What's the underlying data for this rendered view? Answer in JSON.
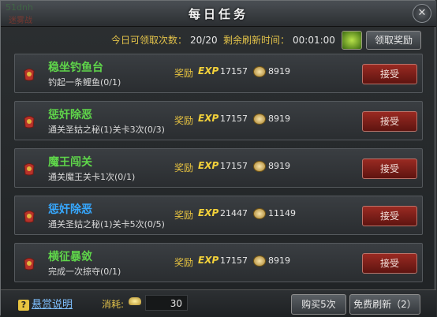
{
  "window": {
    "title": "每日任务",
    "background_text": "51dnh",
    "background_text2": "迷雾战"
  },
  "info": {
    "claims_label": "今日可领取次数：",
    "claims_value": "20/20",
    "refresh_label": "剩余刷新时间：",
    "refresh_value": "00:01:00",
    "claim_button": "领取奖励"
  },
  "reward_label": "奖励",
  "exp_label": "EXP",
  "accept_label": "接受",
  "tasks": [
    {
      "name": "稳坐钓鱼台",
      "desc": "钓起一条鲤鱼(0/1)",
      "exp": "17157",
      "coins": "8919",
      "name_color": "green"
    },
    {
      "name": "惩奸除恶",
      "desc": "通关圣姑之秘(1)关卡3次(0/3)",
      "exp": "17157",
      "coins": "8919",
      "name_color": "green"
    },
    {
      "name": "魔王闯关",
      "desc": "通关魔王关卡1次(0/1)",
      "exp": "17157",
      "coins": "8919",
      "name_color": "green"
    },
    {
      "name": "惩奸除恶",
      "desc": "通关圣姑之秘(1)关卡5次(0/5)",
      "exp": "21447",
      "coins": "11149",
      "name_color": "blue"
    },
    {
      "name": "横征暴敛",
      "desc": "完成一次掠夺(0/1)",
      "exp": "17157",
      "coins": "8919",
      "name_color": "green"
    }
  ],
  "footer": {
    "help": "悬赏说明",
    "consume_label": "消耗:",
    "cost": "30",
    "buy": "购买5次",
    "refresh": "免费刷新（2）"
  }
}
